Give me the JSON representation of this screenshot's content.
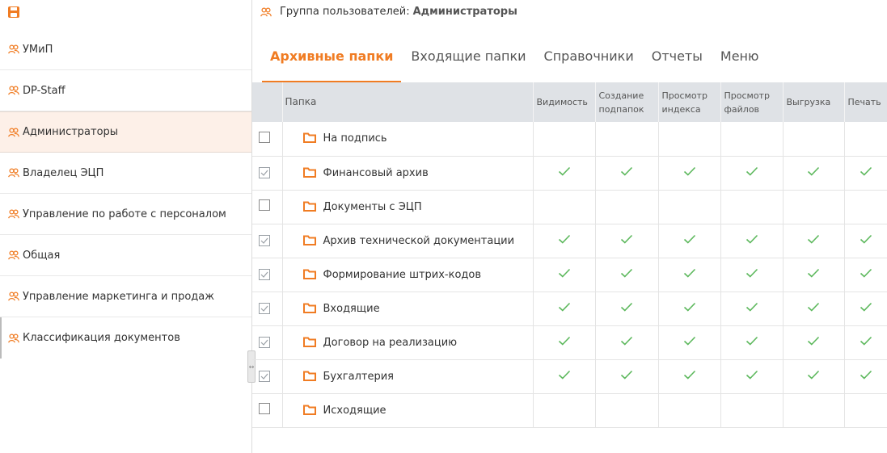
{
  "sidebar": {
    "save_icon": "save-icon",
    "groups": [
      {
        "label": "УМиП"
      },
      {
        "label": "DP-Staff"
      },
      {
        "label": "Администраторы"
      },
      {
        "label": "Владелец ЭЦП"
      },
      {
        "label": "Управление по работе с персоналом"
      },
      {
        "label": "Общая"
      },
      {
        "label": "Управление маркетинга и продаж"
      },
      {
        "label": "Классификация документов"
      }
    ],
    "selected_index": 2
  },
  "header": {
    "label": "Группа пользователей:",
    "value": "Администраторы"
  },
  "tabs": [
    {
      "label": "Архивные папки",
      "active": true
    },
    {
      "label": "Входящие папки"
    },
    {
      "label": "Справочники"
    },
    {
      "label": "Отчеты"
    },
    {
      "label": "Меню"
    }
  ],
  "table": {
    "columns": {
      "folder": "Папка",
      "visibility": "Видимость",
      "create_1": "Создание",
      "create_2": "подпапок",
      "view_index_1": "Просмотр",
      "view_index_2": "индекса",
      "view_files_1": "Просмотр",
      "view_files_2": "файлов",
      "export": "Выгрузка",
      "print": "Печать"
    },
    "rows": [
      {
        "name": "На подпись",
        "checked": false
      },
      {
        "name": "Финансовый архив",
        "checked": true
      },
      {
        "name": "Документы с ЭЦП",
        "checked": false
      },
      {
        "name": "Архив технической документации",
        "checked": true
      },
      {
        "name": "Формирование штрих-кодов",
        "checked": true
      },
      {
        "name": "Входящие",
        "checked": true
      },
      {
        "name": "Договор на реализацию",
        "checked": true
      },
      {
        "name": "Бухгалтерия",
        "checked": true
      },
      {
        "name": "Исходящие",
        "checked": false
      }
    ]
  },
  "colors": {
    "accent": "#f07c23",
    "check": "#5cb85c",
    "header_bg": "#dfe2e6",
    "selected_bg": "#fdf0e8"
  }
}
